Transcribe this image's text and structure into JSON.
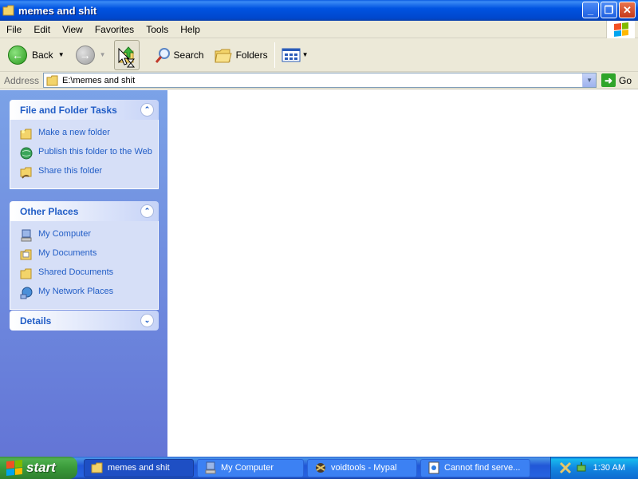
{
  "window": {
    "title": "memes and shit"
  },
  "menu": {
    "items": [
      "File",
      "Edit",
      "View",
      "Favorites",
      "Tools",
      "Help"
    ]
  },
  "toolbar": {
    "back": "Back",
    "search": "Search",
    "folders": "Folders"
  },
  "address": {
    "label": "Address",
    "value": "E:\\memes and shit",
    "go": "Go"
  },
  "left_pane": {
    "file_tasks": {
      "title": "File and Folder Tasks",
      "items": [
        "Make a new folder",
        "Publish this folder to the Web",
        "Share this folder"
      ]
    },
    "other_places": {
      "title": "Other Places",
      "items": [
        "My Computer",
        "My Documents",
        "Shared Documents",
        "My Network Places"
      ]
    },
    "details": {
      "title": "Details"
    }
  },
  "taskbar": {
    "start": "start",
    "buttons": [
      "memes and shit",
      "My Computer",
      "voidtools - Mypal",
      "Cannot find serve..."
    ],
    "clock": "1:30 AM"
  },
  "colors": {
    "accent": "#215dc6",
    "title_bar": "#0053e1",
    "taskbar": "#245edb",
    "start": "#3a9a3a"
  }
}
